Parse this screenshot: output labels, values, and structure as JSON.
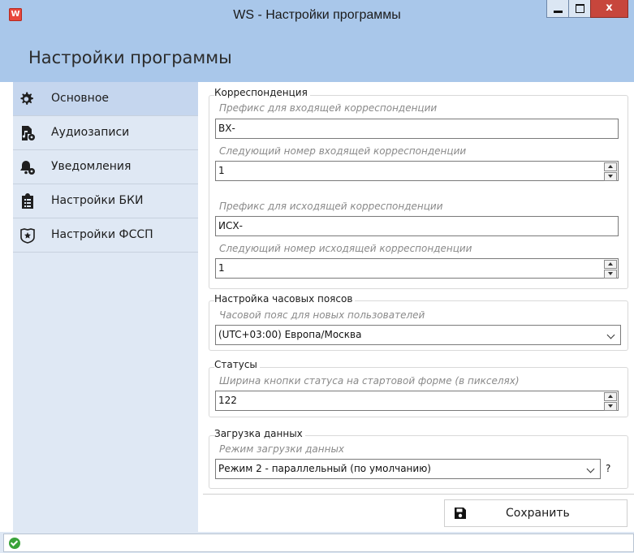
{
  "window": {
    "app_icon_letter": "W",
    "title": "WS - Настройки программы",
    "close_glyph": "x"
  },
  "header": {
    "title": "Настройки программы"
  },
  "sidebar": {
    "items": [
      {
        "label": "Основное",
        "icon": "gear-icon",
        "active": true
      },
      {
        "label": "Аудиозаписи",
        "icon": "audio-file-gear-icon",
        "active": false
      },
      {
        "label": "Уведомления",
        "icon": "bell-gear-icon",
        "active": false
      },
      {
        "label": "Настройки БКИ",
        "icon": "clipboard-list-icon",
        "active": false
      },
      {
        "label": "Настройки ФССП",
        "icon": "shield-star-icon",
        "active": false
      }
    ]
  },
  "correspondence": {
    "legend": "Корреспонденция",
    "in_prefix_label": "Префикс для входящей корреспонденции",
    "in_prefix_value": "ВХ-",
    "in_next_label": "Следующий номер входящей корреспонденции",
    "in_next_value": "1",
    "out_prefix_label": "Префикс для исходящей корреспонденции",
    "out_prefix_value": "ИСХ-",
    "out_next_label": "Следующий номер исходящей корреспонденции",
    "out_next_value": "1"
  },
  "timezones": {
    "legend": "Настройка часовых поясов",
    "label": "Часовой пояс для новых пользователей",
    "value": "(UTC+03:00) Европа/Москва"
  },
  "statuses": {
    "legend": "Статусы",
    "label": "Ширина кнопки статуса на стартовой форме (в пикселях)",
    "value": "122"
  },
  "loading": {
    "legend": "Загрузка данных",
    "label": "Режим загрузки данных",
    "value": "Режим 2 - параллельный (по умолчанию)",
    "help": "?"
  },
  "save_button": {
    "label": "Сохранить",
    "icon": "save-disk-icon"
  },
  "statusbar": {
    "icon": "ok-check-icon"
  },
  "colors": {
    "title_bar": "#a9c7ea",
    "sidebar_bg": "#dfe8f4",
    "sidebar_active": "#c5d6ee",
    "close_button": "#c7463c"
  }
}
